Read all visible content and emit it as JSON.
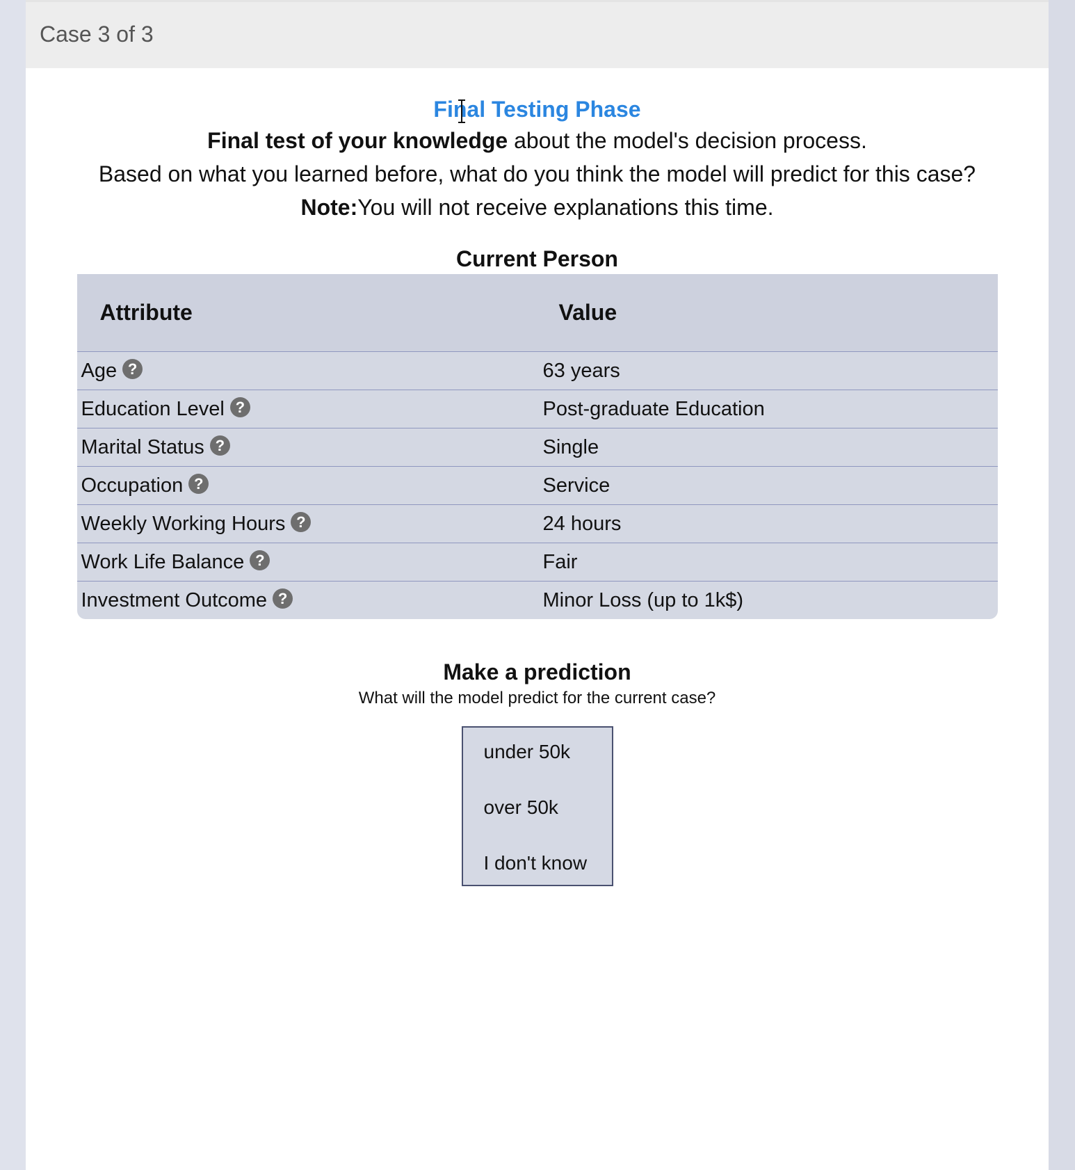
{
  "header": {
    "case_label": "Case 3 of 3"
  },
  "intro": {
    "phase_title": "Final Testing Phase",
    "line1_bold": "Final test of your knowledge",
    "line1_rest": " about the model's decision process.",
    "line2": "Based on what you learned before, what do you think the model will predict for this case?",
    "line3_bold": "Note:",
    "line3_rest": "You will not receive explanations this time."
  },
  "person": {
    "title": "Current Person",
    "header_attribute": "Attribute",
    "header_value": "Value",
    "help_glyph": "?",
    "rows": [
      {
        "attribute": "Age",
        "value": "63 years"
      },
      {
        "attribute": "Education Level",
        "value": "Post-graduate Education"
      },
      {
        "attribute": "Marital Status",
        "value": "Single"
      },
      {
        "attribute": "Occupation",
        "value": "Service"
      },
      {
        "attribute": "Weekly Working Hours",
        "value": "24 hours"
      },
      {
        "attribute": "Work Life Balance",
        "value": "Fair"
      },
      {
        "attribute": "Investment Outcome",
        "value": "Minor Loss (up to 1k$)"
      }
    ]
  },
  "prediction": {
    "title": "Make a prediction",
    "subtitle": "What will the model predict for the current case?",
    "options": [
      "under 50k",
      "over 50k",
      "I don't know"
    ]
  },
  "colors": {
    "accent": "#2b86e0",
    "table_bg": "#d4d8e3",
    "header_bg": "#ededed"
  }
}
